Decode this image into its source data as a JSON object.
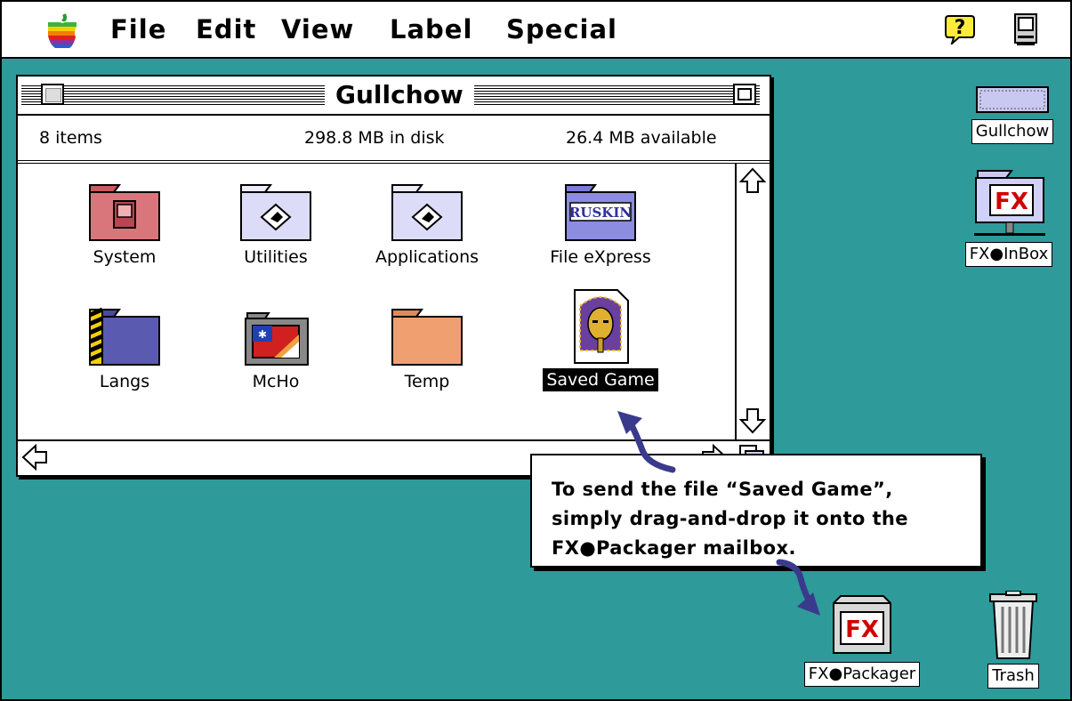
{
  "menubar": {
    "apple_icon": "apple-icon",
    "menus": [
      "File",
      "Edit",
      "View",
      "Label",
      "Special"
    ],
    "help_icon": "help-balloon-icon",
    "app_icon": "finder-app-icon"
  },
  "window": {
    "title": "Gullchow",
    "items_count": "8 items",
    "disk_used": "298.8 MB in disk",
    "disk_available": "26.4 MB available",
    "items": [
      {
        "label": "System",
        "icon": "system-folder-icon",
        "selected": false
      },
      {
        "label": "Utilities",
        "icon": "utilities-folder-icon",
        "selected": false
      },
      {
        "label": "Applications",
        "icon": "applications-folder-icon",
        "selected": false
      },
      {
        "label": "File eXpress",
        "icon": "ruskin-folder-icon",
        "selected": false
      },
      {
        "label": "Langs",
        "icon": "langs-folder-icon",
        "selected": false
      },
      {
        "label": "McHo",
        "icon": "mcho-app-icon",
        "selected": false
      },
      {
        "label": "Temp",
        "icon": "temp-folder-icon",
        "selected": false
      },
      {
        "label": "Saved Game",
        "icon": "pharaoh-document-icon",
        "selected": true
      }
    ]
  },
  "desktop": {
    "disk": {
      "label": "Gullchow",
      "icon": "hard-disk-icon"
    },
    "inbox": {
      "label": "FX●InBox",
      "icon": "fx-inbox-icon",
      "badge": "FX"
    },
    "packager": {
      "label": "FX●Packager",
      "icon": "fx-packager-mailbox-icon",
      "badge": "FX"
    },
    "trash": {
      "label": "Trash",
      "icon": "trash-icon"
    }
  },
  "callout": {
    "lines": [
      "To send the file “Saved Game”,",
      "simply drag-and-drop it onto the",
      "FX●Packager mailbox."
    ]
  },
  "colors": {
    "desktop": "#2e9a9a",
    "arrow": "#3a3a8c",
    "fx_red": "#d00000",
    "fx_blue": "#2030c0"
  }
}
